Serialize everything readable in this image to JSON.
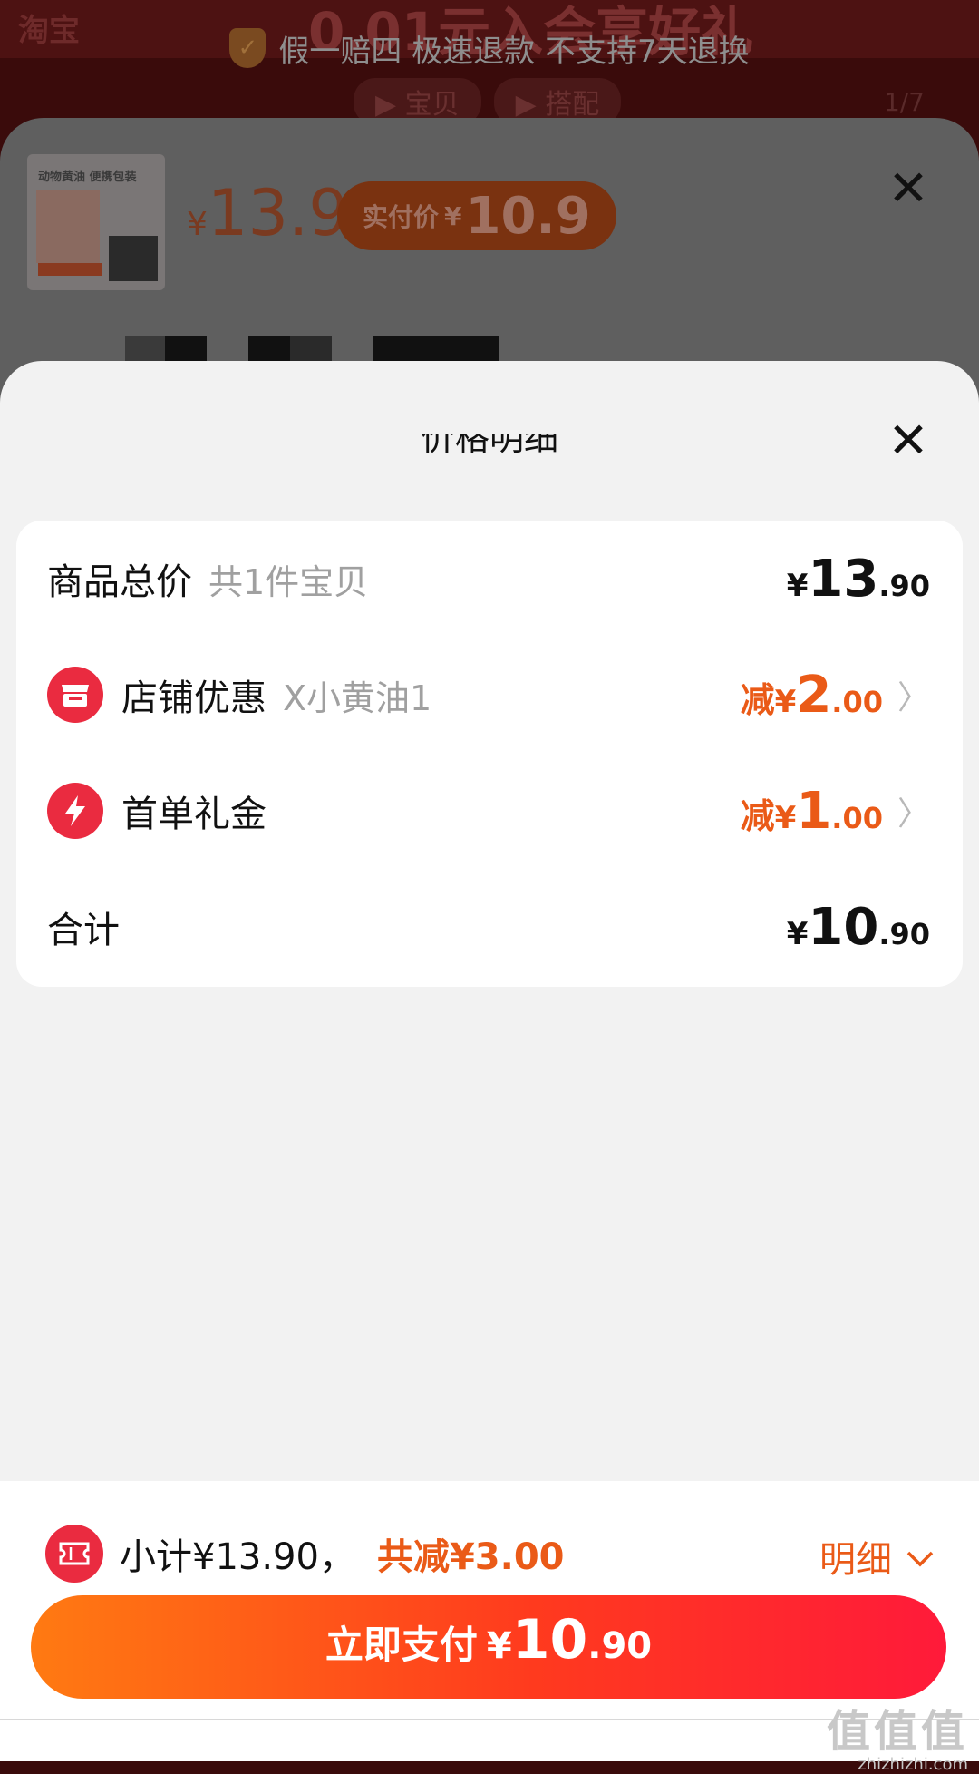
{
  "background": {
    "banner_text": "0.01元入会享好礼",
    "logo_text": "淘宝",
    "guarantee_text": "假一赔四 极速退款 不支持7天退换",
    "tabs": [
      "▶ 宝贝",
      "▶ 搭配"
    ],
    "counter": "1/7"
  },
  "product_sheet": {
    "thumb_text": "动物黄油 便携包装",
    "price_symbol": "¥",
    "price": "13.9",
    "real_price_label": "实付价",
    "real_price_symbol": "¥",
    "real_price": "10.9"
  },
  "price_detail": {
    "title": "价格明细",
    "rows": [
      {
        "name": "商品总价",
        "sub": "共1件宝贝",
        "prefix": "",
        "yen": "¥",
        "int": "13",
        "dec": ".90"
      },
      {
        "name": "店铺优惠",
        "sub": "X小黄油1",
        "prefix": "减",
        "yen": "¥",
        "int": "2",
        "dec": ".00",
        "icon": "store-icon"
      },
      {
        "name": "首单礼金",
        "sub": "",
        "prefix": "减",
        "yen": "¥",
        "int": "1",
        "dec": ".00",
        "icon": "lightning-icon"
      },
      {
        "name": "合计",
        "sub": "",
        "prefix": "",
        "yen": "¥",
        "int": "10",
        "dec": ".90"
      }
    ]
  },
  "bottom_bar": {
    "subtotal": "小计¥13.90，",
    "discount": "共减¥3.00",
    "detail_label": "明细",
    "pay_label": "立即支付",
    "pay_yen": "¥",
    "pay_int": "10",
    "pay_dec": ".90"
  },
  "watermark": {
    "main": "值值值",
    "sub": "zhizhizhi.com"
  },
  "colors": {
    "accent": "#ea5a17",
    "brand_red": "#ea2b40",
    "pay_gradient_start": "#ff7a12",
    "pay_gradient_end": "#ff1a3a"
  },
  "icons": [
    "store-icon",
    "lightning-icon",
    "ticket-icon",
    "chevron-right-icon",
    "chevron-down-icon",
    "close-icon",
    "shield-icon"
  ]
}
